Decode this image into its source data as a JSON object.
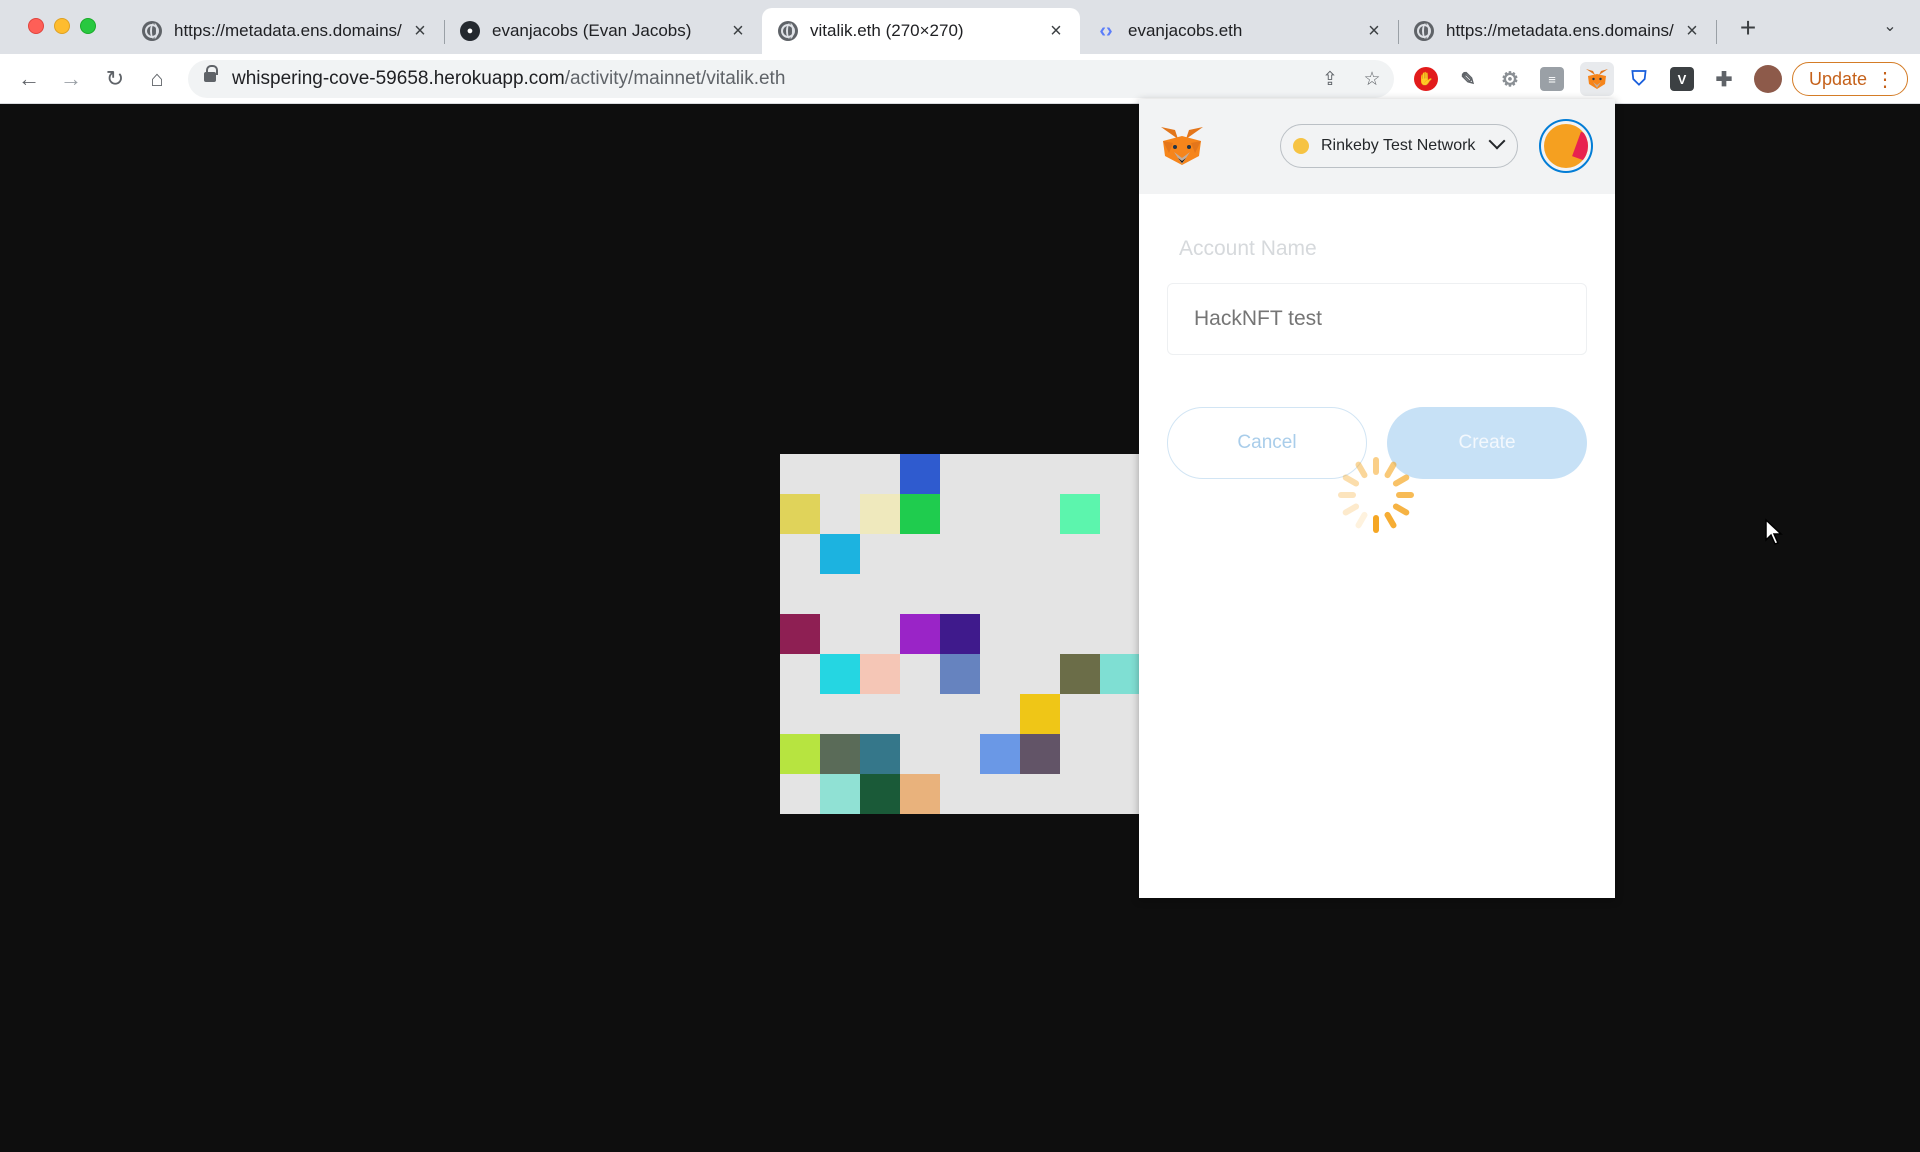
{
  "browser": {
    "tabs": [
      {
        "title": "https://metadata.ens.domains/mainnet/",
        "icon": "globe-icon",
        "active": false
      },
      {
        "title": "evanjacobs (Evan Jacobs)",
        "icon": "github-icon",
        "active": false
      },
      {
        "title": "vitalik.eth (270×270)",
        "icon": "globe-icon",
        "active": true
      },
      {
        "title": "evanjacobs.eth",
        "icon": "ens-icon",
        "active": false
      },
      {
        "title": "https://metadata.ens.domains/mainnet/",
        "icon": "globe-icon",
        "active": false
      }
    ],
    "url_host": "whispering-cove-59658.herokuapp.com",
    "url_path": "/activity/mainnet/vitalik.eth",
    "update_label": "Update"
  },
  "identicon": {
    "background": "#e4e4e4",
    "cells": [
      {
        "col": 3,
        "row": 0,
        "color": "#2f5bcf"
      },
      {
        "col": 0,
        "row": 1,
        "color": "#e0d35a"
      },
      {
        "col": 2,
        "row": 1,
        "color": "#efe9bd"
      },
      {
        "col": 3,
        "row": 1,
        "color": "#1fcc4e"
      },
      {
        "col": 7,
        "row": 1,
        "color": "#5cf5ad"
      },
      {
        "col": 1,
        "row": 2,
        "color": "#1cb3e0"
      },
      {
        "col": 0,
        "row": 4,
        "color": "#8e1f53"
      },
      {
        "col": 3,
        "row": 4,
        "color": "#9a24c7"
      },
      {
        "col": 4,
        "row": 4,
        "color": "#3f1a8c"
      },
      {
        "col": 1,
        "row": 5,
        "color": "#25d6e2"
      },
      {
        "col": 2,
        "row": 5,
        "color": "#f5c6b6"
      },
      {
        "col": 4,
        "row": 5,
        "color": "#6683bf"
      },
      {
        "col": 7,
        "row": 5,
        "color": "#6b6d48"
      },
      {
        "col": 8,
        "row": 5,
        "color": "#7fdfd3"
      },
      {
        "col": 6,
        "row": 6,
        "color": "#efc617"
      },
      {
        "col": 0,
        "row": 7,
        "color": "#b7e440"
      },
      {
        "col": 1,
        "row": 7,
        "color": "#5a6b58"
      },
      {
        "col": 2,
        "row": 7,
        "color": "#35778a"
      },
      {
        "col": 5,
        "row": 7,
        "color": "#6a98e6"
      },
      {
        "col": 6,
        "row": 7,
        "color": "#625467"
      },
      {
        "col": 1,
        "row": 8,
        "color": "#90e1d4"
      },
      {
        "col": 2,
        "row": 8,
        "color": "#1a5a38"
      },
      {
        "col": 3,
        "row": 8,
        "color": "#e9b27c"
      }
    ]
  },
  "metamask": {
    "network_label": "Rinkeby Test Network",
    "network_color": "#f6c343",
    "account_name_label": "Account Name",
    "account_name_placeholder": "HackNFT test",
    "cancel_label": "Cancel",
    "create_label": "Create"
  }
}
